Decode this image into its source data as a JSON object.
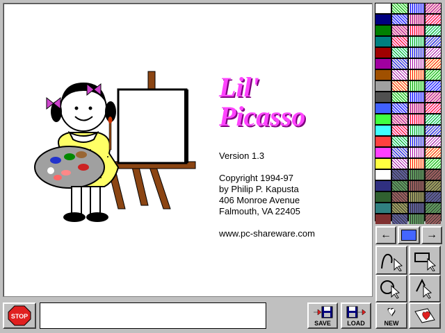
{
  "app": {
    "title_line1": "Lil'",
    "title_line2": "Picasso",
    "version": "Version 1.3",
    "copyright": "Copyright 1994-97",
    "author": "by Philip P. Kapusta",
    "address1": "406 Monroe Avenue",
    "address2": "Falmouth, VA 22405",
    "website": "www.pc-shareware.com"
  },
  "toolbar": {
    "stop_label": "STOP",
    "save_label": "SAVE",
    "load_label": "LOAD",
    "new_label": "NEW"
  },
  "status_text": "",
  "colors": {
    "accent_title": "#ff44ff",
    "selected_color": "#4466ff",
    "stop_red": "#e02020"
  },
  "palette_swatches": [
    "#ffffff",
    "#000080",
    "#008000",
    "#008080",
    "#a00000",
    "#a000a0",
    "#a05000",
    "#a0a0a0",
    "#505050",
    "#4060ff",
    "#40ff40",
    "#40ffff",
    "#ff4040",
    "#ff40ff",
    "#ffff40",
    "#ffffff"
  ]
}
